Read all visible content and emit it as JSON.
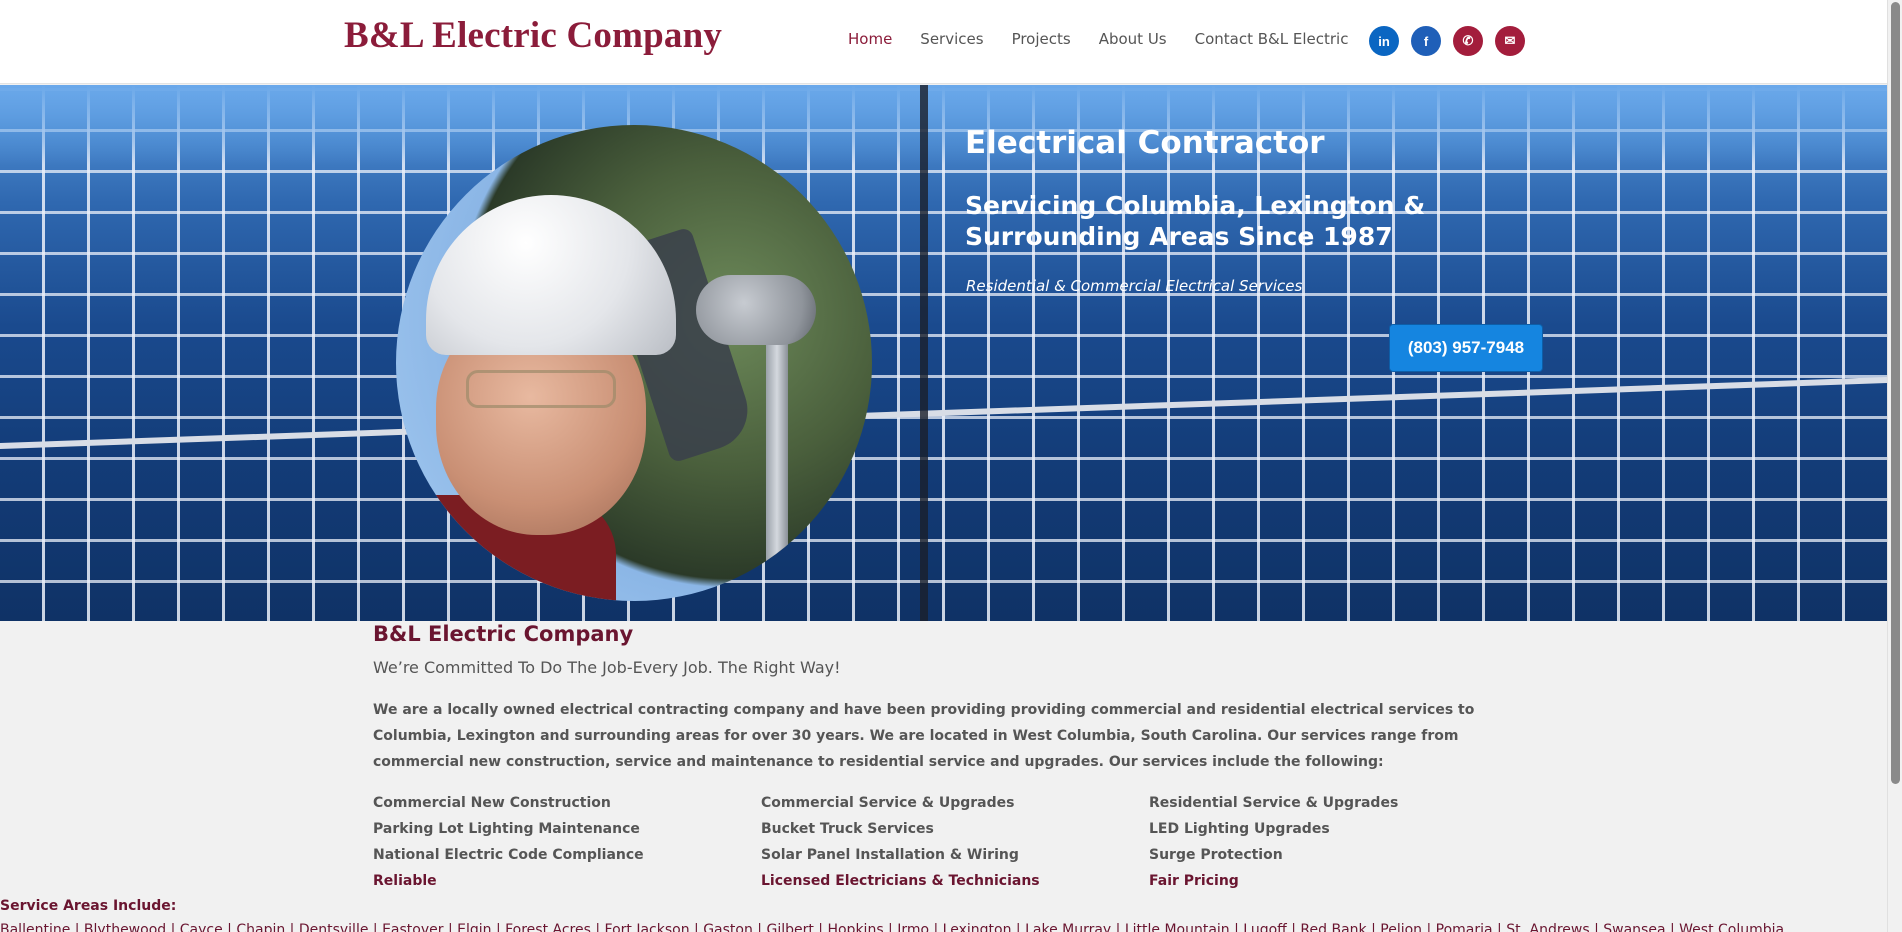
{
  "header": {
    "logo": "B&L Electric Company",
    "nav": [
      "Home",
      "Services",
      "Projects",
      "About Us",
      "Contact B&L Electric"
    ],
    "active_nav": "Home",
    "socials": [
      {
        "name": "linkedin-icon",
        "glyph": "in"
      },
      {
        "name": "facebook-icon",
        "glyph": "f"
      },
      {
        "name": "phone-icon",
        "glyph": "✆"
      },
      {
        "name": "email-icon",
        "glyph": "✉"
      }
    ]
  },
  "hero": {
    "title": "Electrical Contractor",
    "subtitle": "Servicing Columbia, Lexington & Surrounding Areas Since 1987",
    "tagline": "Residential & Commercial Electrical Services",
    "phone_button": "(803) 957-7948"
  },
  "content": {
    "company_title": "B&L Electric Company",
    "motto": "We’re Committed To Do The Job-Every Job. The Right Way!",
    "intro": "We are a locally owned electrical contracting company and have been providing providing commercial and residential electrical services to Columbia, Lexington and surrounding areas for over 30 years. We are located in West Columbia, South Carolina. Our services range from commercial new construction, service and maintenance to residential service and upgrades. Our services include the following:",
    "services": [
      {
        "label": "Commercial New Construction",
        "highlight": false
      },
      {
        "label": "Commercial Service & Upgrades",
        "highlight": false
      },
      {
        "label": "Residential Service & Upgrades",
        "highlight": false
      },
      {
        "label": "Parking Lot Lighting Maintenance",
        "highlight": false
      },
      {
        "label": "Bucket Truck Services",
        "highlight": false
      },
      {
        "label": "LED Lighting Upgrades",
        "highlight": false
      },
      {
        "label": "National Electric Code Compliance",
        "highlight": false
      },
      {
        "label": "Solar Panel Installation & Wiring",
        "highlight": false
      },
      {
        "label": "Surge Protection",
        "highlight": false
      },
      {
        "label": "Reliable",
        "highlight": true
      },
      {
        "label": "Licensed Electricians & Technicians",
        "highlight": true
      },
      {
        "label": "Fair Pricing",
        "highlight": true
      }
    ],
    "areas_title": "Service Areas Include:",
    "areas_list": "Ballentine | Blythewood | Cayce | Chapin | Dentsville | Eastover | Elgin | Forest Acres | Fort Jackson | Gaston | Gilbert | Hopkins | Irmo | Lexington | Lake Murray | Little Mountain | Lugoff | Red Bank | Pelion | Pomaria | St. Andrews | Swansea | West Columbia"
  },
  "colors": {
    "brand": "#8b1c3a",
    "button": "#1585e0",
    "social_blue": "#0a66c2",
    "social_red": "#a31d3c"
  }
}
